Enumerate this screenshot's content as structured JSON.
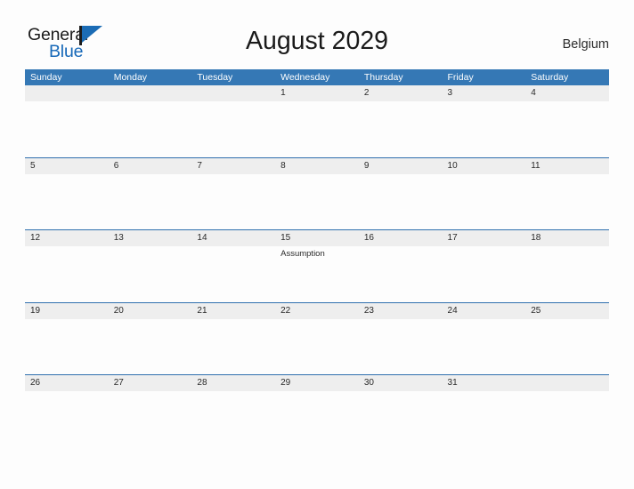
{
  "brand": {
    "name_part1": "General",
    "name_part2": "Blue",
    "flag_icon": "flag-triangle-icon"
  },
  "header": {
    "title": "August 2029",
    "country": "Belgium"
  },
  "colors": {
    "header_blue": "#3578B5",
    "row_divider_blue": "#2F6FAE",
    "date_strip_gray": "#EEEEEE",
    "brand_blue": "#1668B8",
    "page_background": "#FDFDFD"
  },
  "calendar": {
    "month": "August",
    "year": "2029",
    "weekday_headers": [
      "Sunday",
      "Monday",
      "Tuesday",
      "Wednesday",
      "Thursday",
      "Friday",
      "Saturday"
    ],
    "weeks": [
      {
        "days": [
          {
            "number": "",
            "event": ""
          },
          {
            "number": "",
            "event": ""
          },
          {
            "number": "",
            "event": ""
          },
          {
            "number": "1",
            "event": ""
          },
          {
            "number": "2",
            "event": ""
          },
          {
            "number": "3",
            "event": ""
          },
          {
            "number": "4",
            "event": ""
          }
        ]
      },
      {
        "days": [
          {
            "number": "5",
            "event": ""
          },
          {
            "number": "6",
            "event": ""
          },
          {
            "number": "7",
            "event": ""
          },
          {
            "number": "8",
            "event": ""
          },
          {
            "number": "9",
            "event": ""
          },
          {
            "number": "10",
            "event": ""
          },
          {
            "number": "11",
            "event": ""
          }
        ]
      },
      {
        "days": [
          {
            "number": "12",
            "event": ""
          },
          {
            "number": "13",
            "event": ""
          },
          {
            "number": "14",
            "event": ""
          },
          {
            "number": "15",
            "event": "Assumption"
          },
          {
            "number": "16",
            "event": ""
          },
          {
            "number": "17",
            "event": ""
          },
          {
            "number": "18",
            "event": ""
          }
        ]
      },
      {
        "days": [
          {
            "number": "19",
            "event": ""
          },
          {
            "number": "20",
            "event": ""
          },
          {
            "number": "21",
            "event": ""
          },
          {
            "number": "22",
            "event": ""
          },
          {
            "number": "23",
            "event": ""
          },
          {
            "number": "24",
            "event": ""
          },
          {
            "number": "25",
            "event": ""
          }
        ]
      },
      {
        "days": [
          {
            "number": "26",
            "event": ""
          },
          {
            "number": "27",
            "event": ""
          },
          {
            "number": "28",
            "event": ""
          },
          {
            "number": "29",
            "event": ""
          },
          {
            "number": "30",
            "event": ""
          },
          {
            "number": "31",
            "event": ""
          },
          {
            "number": "",
            "event": ""
          }
        ]
      }
    ]
  }
}
